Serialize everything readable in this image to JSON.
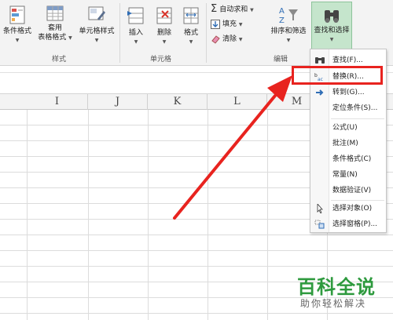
{
  "ribbon": {
    "styles_group": {
      "label": "样式",
      "conditional_format": "条件格式",
      "format_as_table_line1": "套用",
      "format_as_table_line2": "表格格式",
      "cell_styles": "单元格样式"
    },
    "cells_group": {
      "label": "单元格",
      "insert": "插入",
      "delete": "删除",
      "format": "格式"
    },
    "editing_group": {
      "label": "编辑",
      "autosum": "自动求和",
      "fill": "填充",
      "clear": "清除",
      "sort_filter": "排序和筛选",
      "find_select": "查找和选择"
    }
  },
  "columns": [
    "I",
    "J",
    "K",
    "L",
    "M"
  ],
  "menu": {
    "items": [
      {
        "label": "查找(F)...",
        "icon": "binoculars-icon"
      },
      {
        "label": "替换(R)...",
        "icon": "replace-abc-icon"
      },
      {
        "label": "转到(G)...",
        "icon": "arrow-right-icon"
      },
      {
        "label": "定位条件(S)...",
        "icon": ""
      },
      {
        "label": "公式(U)",
        "icon": ""
      },
      {
        "label": "批注(M)",
        "icon": ""
      },
      {
        "label": "条件格式(C)",
        "icon": ""
      },
      {
        "label": "常量(N)",
        "icon": ""
      },
      {
        "label": "数据验证(V)",
        "icon": ""
      },
      {
        "label": "选择对象(O)",
        "icon": "cursor-arrow-icon"
      },
      {
        "label": "选择窗格(P)...",
        "icon": "selection-pane-icon"
      }
    ]
  },
  "watermark": {
    "title": "百科全说",
    "subtitle": "助你轻松解决"
  },
  "colors": {
    "annotation_red": "#e8231f",
    "watermark_green": "#2e9a3e",
    "active_button_bg": "#c5e5cc"
  }
}
